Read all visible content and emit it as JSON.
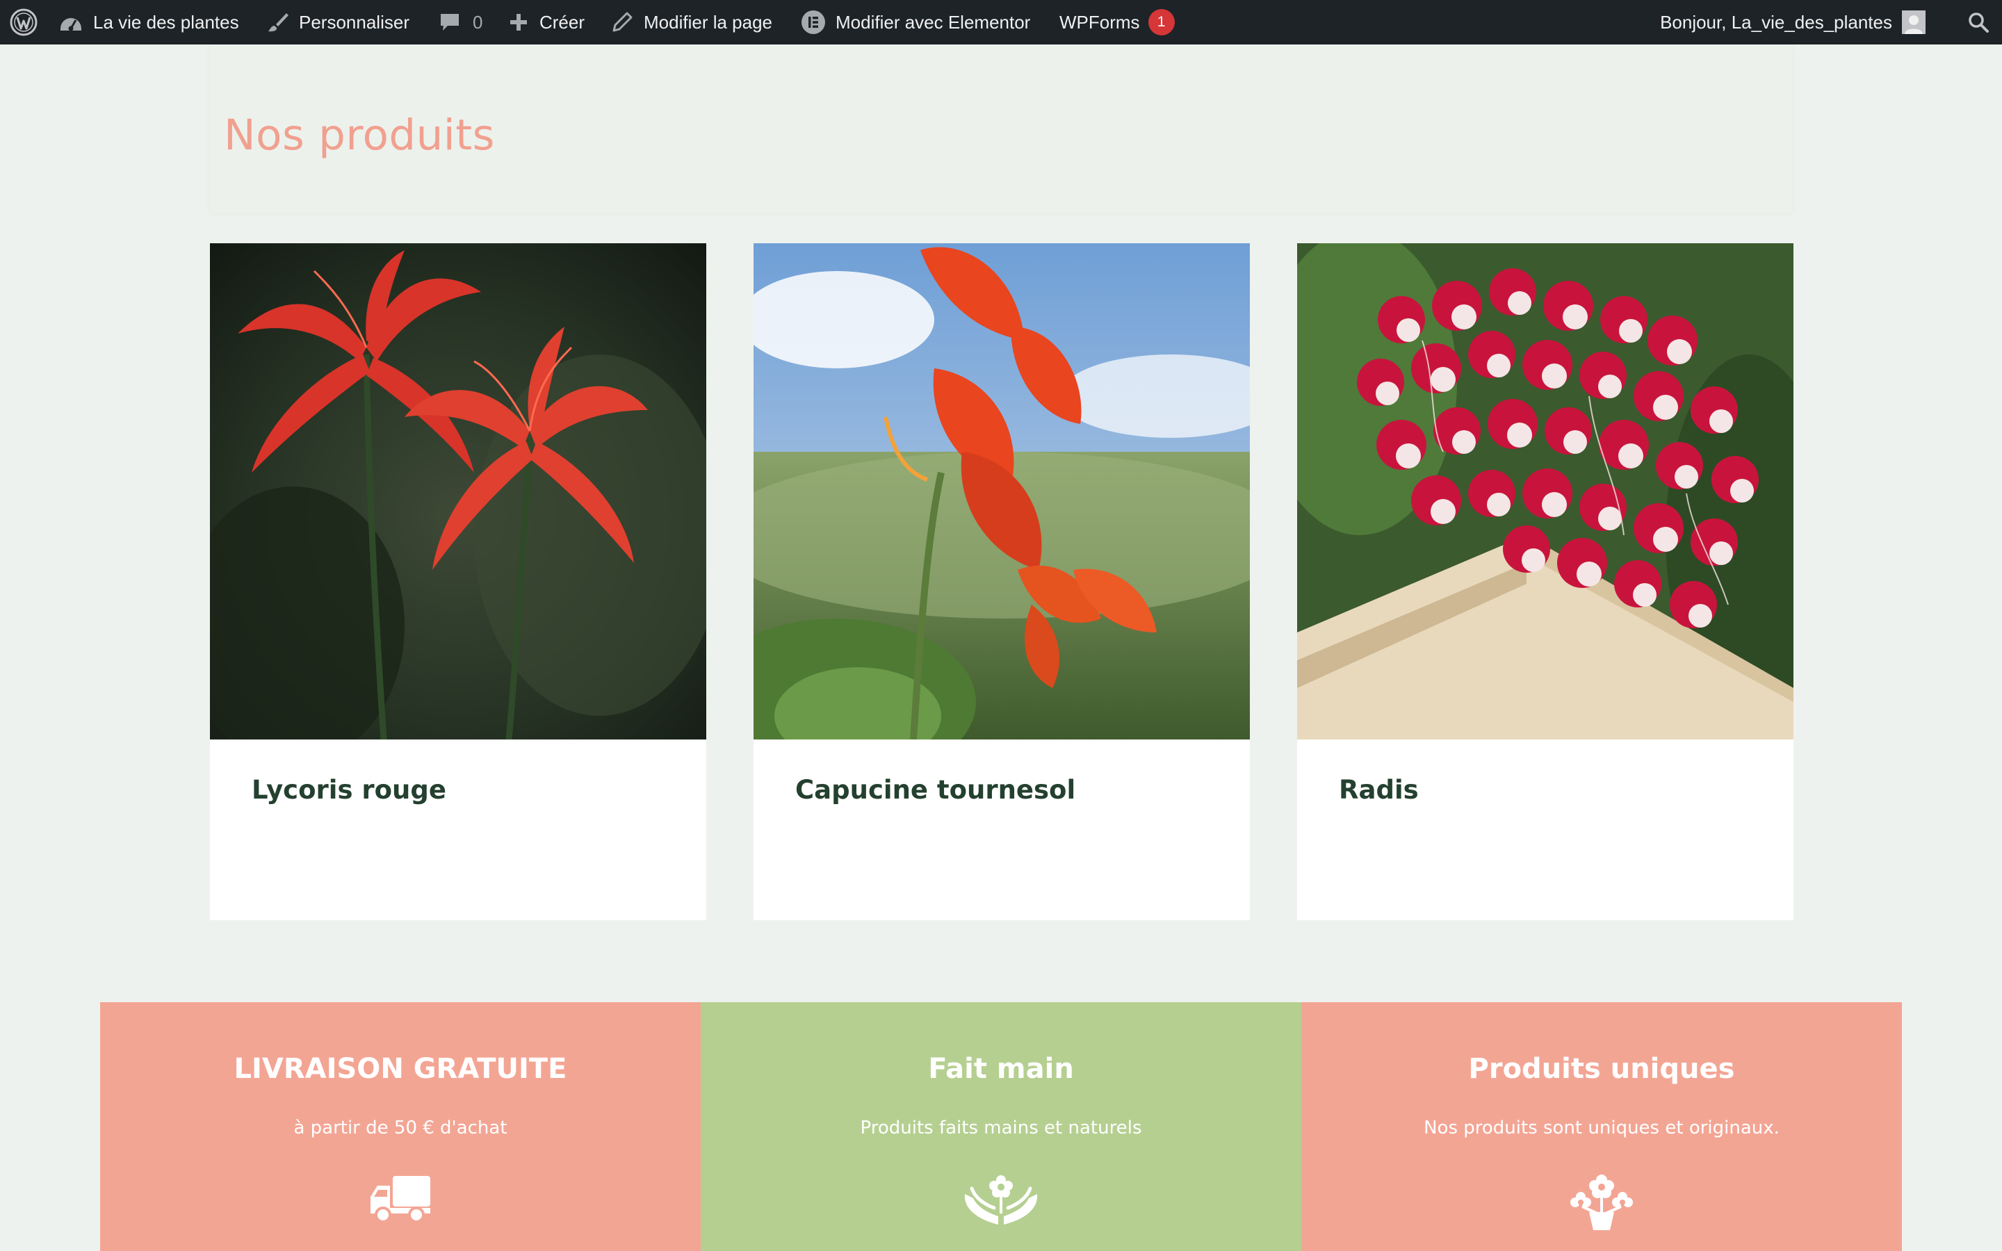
{
  "admin_bar": {
    "site_name": "La vie des plantes",
    "customize": "Personnaliser",
    "comments_count": "0",
    "new": "Créer",
    "edit_page": "Modifier la page",
    "elementor": "Modifier avec Elementor",
    "wpforms": "WPForms",
    "wpforms_badge": "1",
    "greeting": "Bonjour, La_vie_des_plantes"
  },
  "page": {
    "title": "Nos produits"
  },
  "products": [
    {
      "name": "Lycoris rouge",
      "image": "red-spider-lily-photo"
    },
    {
      "name": "Capucine tournesol",
      "image": "nasturtium-photo"
    },
    {
      "name": "Radis",
      "image": "radishes-crate-photo"
    }
  ],
  "features": [
    {
      "title": "LIVRAISON GRATUITE",
      "text": "à partir de 50 € d'achat",
      "icon": "truck-icon",
      "color": "#f3a594"
    },
    {
      "title": "Fait main",
      "text": "Produits faits mains et naturels",
      "icon": "hands-flower-icon",
      "color": "#b5cf91"
    },
    {
      "title": "Produits uniques",
      "text": "Nos produits sont uniques et originaux.",
      "icon": "flower-pot-icon",
      "color": "#f3a594"
    }
  ],
  "colors": {
    "admin_bar": "#1d2327",
    "title": "#f1a08f",
    "product_name": "#24402f",
    "page_bg": "#eef2ee"
  }
}
